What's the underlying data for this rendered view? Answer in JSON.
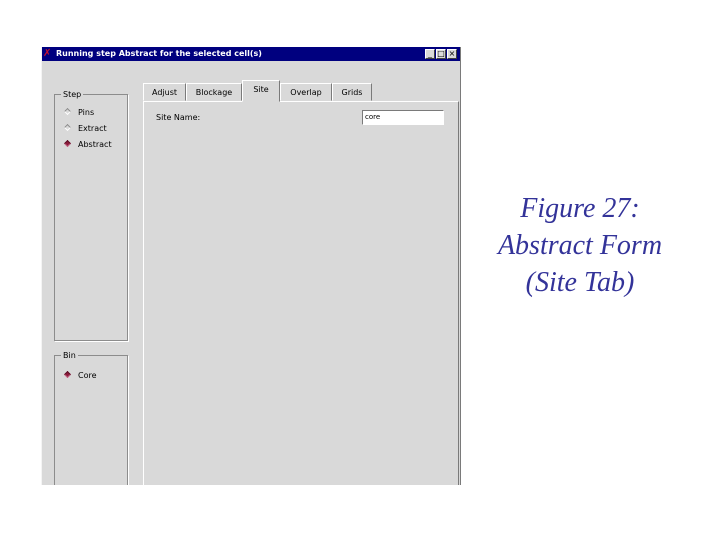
{
  "window": {
    "title": "Running step Abstract for the selected cell(s)",
    "controls": {
      "minimize": "_",
      "maximize": "□",
      "close": "×"
    }
  },
  "step_group": {
    "label": "Step",
    "options": [
      {
        "label": "Pins",
        "selected": false
      },
      {
        "label": "Extract",
        "selected": false
      },
      {
        "label": "Abstract",
        "selected": true
      }
    ]
  },
  "bin_group": {
    "label": "Bin",
    "options": [
      {
        "label": "Core",
        "selected": true
      }
    ]
  },
  "tabs": [
    {
      "label": "Adjust",
      "active": false
    },
    {
      "label": "Blockage",
      "active": false
    },
    {
      "label": "Site",
      "active": true
    },
    {
      "label": "Overlap",
      "active": false
    },
    {
      "label": "Grids",
      "active": false
    }
  ],
  "site_tab": {
    "site_name_label": "Site Name:",
    "site_name_value": "core"
  },
  "caption": {
    "line1": "Figure 27:",
    "line2": "Abstract Form",
    "line3": "(Site Tab)"
  },
  "colors": {
    "titlebar": "#00007f",
    "window_bg": "#d9d9d9",
    "caption": "#333399",
    "radio_selected": "#8b1a3a"
  }
}
